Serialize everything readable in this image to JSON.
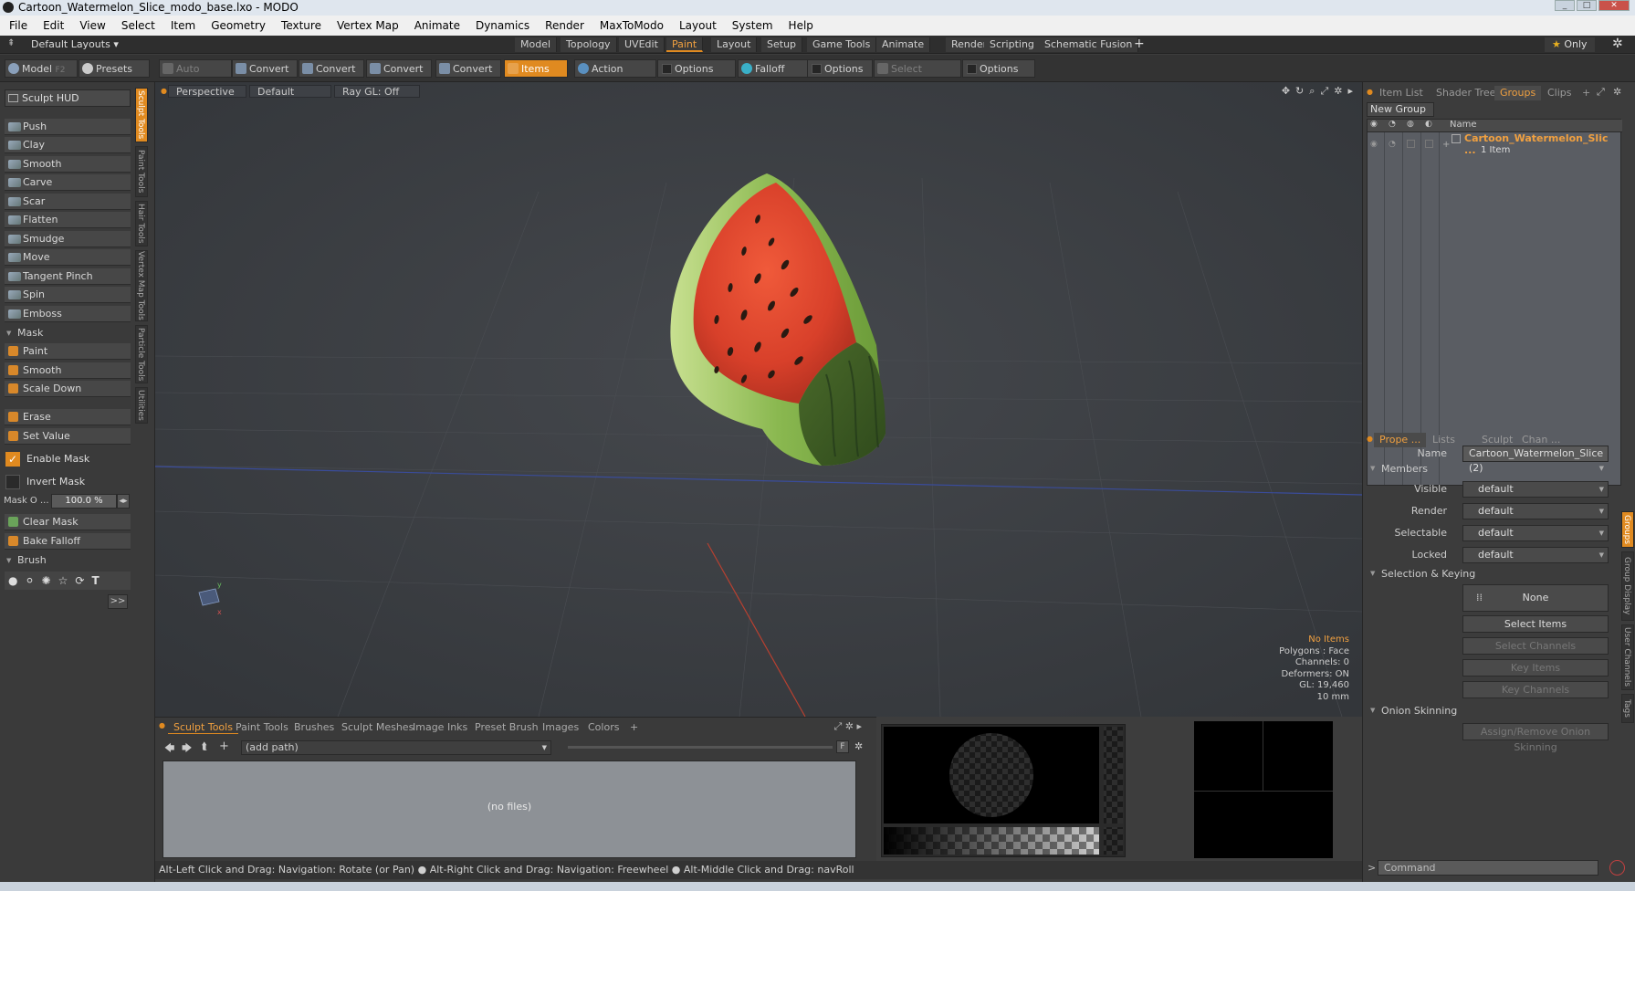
{
  "window": {
    "title": "Cartoon_Watermelon_Slice_modo_base.lxo - MODO"
  },
  "menu": [
    "File",
    "Edit",
    "View",
    "Select",
    "Item",
    "Geometry",
    "Texture",
    "Vertex Map",
    "Animate",
    "Dynamics",
    "Render",
    "MaxToModo",
    "Layout",
    "System",
    "Help"
  ],
  "layout_bar": {
    "default_layouts": "Default Layouts",
    "tabs": [
      "Model",
      "Topology",
      "UVEdit",
      "Paint",
      "Layout",
      "Setup",
      "Game Tools",
      "Animate",
      "Render",
      "Scripting",
      "Schematic Fusion"
    ],
    "active_tab": "Paint",
    "add": "+",
    "only": "Only"
  },
  "toolbar": {
    "model": "Model",
    "model_key": "F2",
    "presets": "Presets",
    "presets_key": "F6",
    "auto_select": "Auto Select",
    "convert1": "Convert",
    "convert2": "Convert",
    "convert3": "Convert",
    "convert4": "Convert",
    "items": "Items",
    "action_center": "Action Center",
    "options1": "Options",
    "falloff": "Falloff",
    "options2": "Options",
    "select_through": "Select Through",
    "options3": "Options"
  },
  "left_tools": {
    "hud": "Sculpt HUD",
    "sculpt": [
      "Push",
      "Clay",
      "Smooth",
      "Carve",
      "Scar",
      "Flatten",
      "Smudge",
      "Move",
      "Tangent Pinch",
      "Spin",
      "Emboss"
    ],
    "mask_section": "Mask",
    "mask": [
      "Paint",
      "Smooth",
      "Scale Down"
    ],
    "erase": "Erase",
    "set_value": "Set Value",
    "enable_mask": "Enable Mask",
    "invert_mask": "Invert Mask",
    "mask_opacity_label": "Mask O ...",
    "mask_opacity_value": "100.0 %",
    "clear_mask": "Clear Mask",
    "bake_falloff": "Bake Falloff",
    "brush_section": "Brush",
    "more": ">>",
    "vtabs": [
      "Sculpt Tools",
      "Paint Tools",
      "Hair Tools",
      "Vertex Map Tools",
      "Particle Tools",
      "Utilities"
    ]
  },
  "viewport": {
    "view": "Perspective",
    "shading": "Default",
    "raygl": "Ray GL: Off",
    "info": {
      "no_items": "No Items",
      "polygons": "Polygons : Face",
      "channels": "Channels: 0",
      "deformers": "Deformers: ON",
      "gl": "GL: 19,460",
      "scale": "10 mm"
    }
  },
  "bottom": {
    "tabs": [
      "Sculpt Tools",
      "Paint Tools",
      "Brushes",
      "Sculpt Meshes",
      "Image Inks",
      "Preset Brush",
      "Images",
      "Colors"
    ],
    "active_tab": "Sculpt Tools",
    "add": "+",
    "path": "(add path)",
    "f": "F",
    "no_files": "(no files)"
  },
  "status": "Alt-Left Click and Drag: Navigation: Rotate (or Pan) ● Alt-Right Click and Drag: Navigation: Freewheel ● Alt-Middle Click and Drag: navRoll",
  "right": {
    "top_tabs": [
      "Item List",
      "Shader Tree",
      "Groups",
      "Clips"
    ],
    "active_top_tab": "Groups",
    "add": "+",
    "new_group": "New Group",
    "col_name": "Name",
    "group_name": "Cartoon_Watermelon_Slic ...",
    "group_count": "1 Item",
    "props_tabs": [
      "Prope ...",
      "Lists",
      "Sculpt",
      "Chan ..."
    ],
    "active_props_tab": "Prope ...",
    "props": {
      "name_label": "Name",
      "name_value": "Cartoon_Watermelon_Slice (2)",
      "members": "Members",
      "visible_label": "Visible",
      "visible": "default",
      "render_label": "Render",
      "render": "default",
      "selectable_label": "Selectable",
      "selectable": "default",
      "locked_label": "Locked",
      "locked": "default",
      "sel_keying": "Selection & Keying",
      "none": "None",
      "select_items": "Select Items",
      "select_channels": "Select Channels",
      "key_items": "Key Items",
      "key_channels": "Key Channels",
      "onion": "Onion Skinning",
      "assign_onion": "Assign/Remove Onion Skinning"
    },
    "side_tabs": [
      "Groups",
      "Group Display",
      "User Channels",
      "Tags"
    ],
    "command": "Command",
    "cmd_prompt": ">"
  },
  "colors": {
    "accent": "#e08a20",
    "viewport_bg": "#3a3d41"
  }
}
